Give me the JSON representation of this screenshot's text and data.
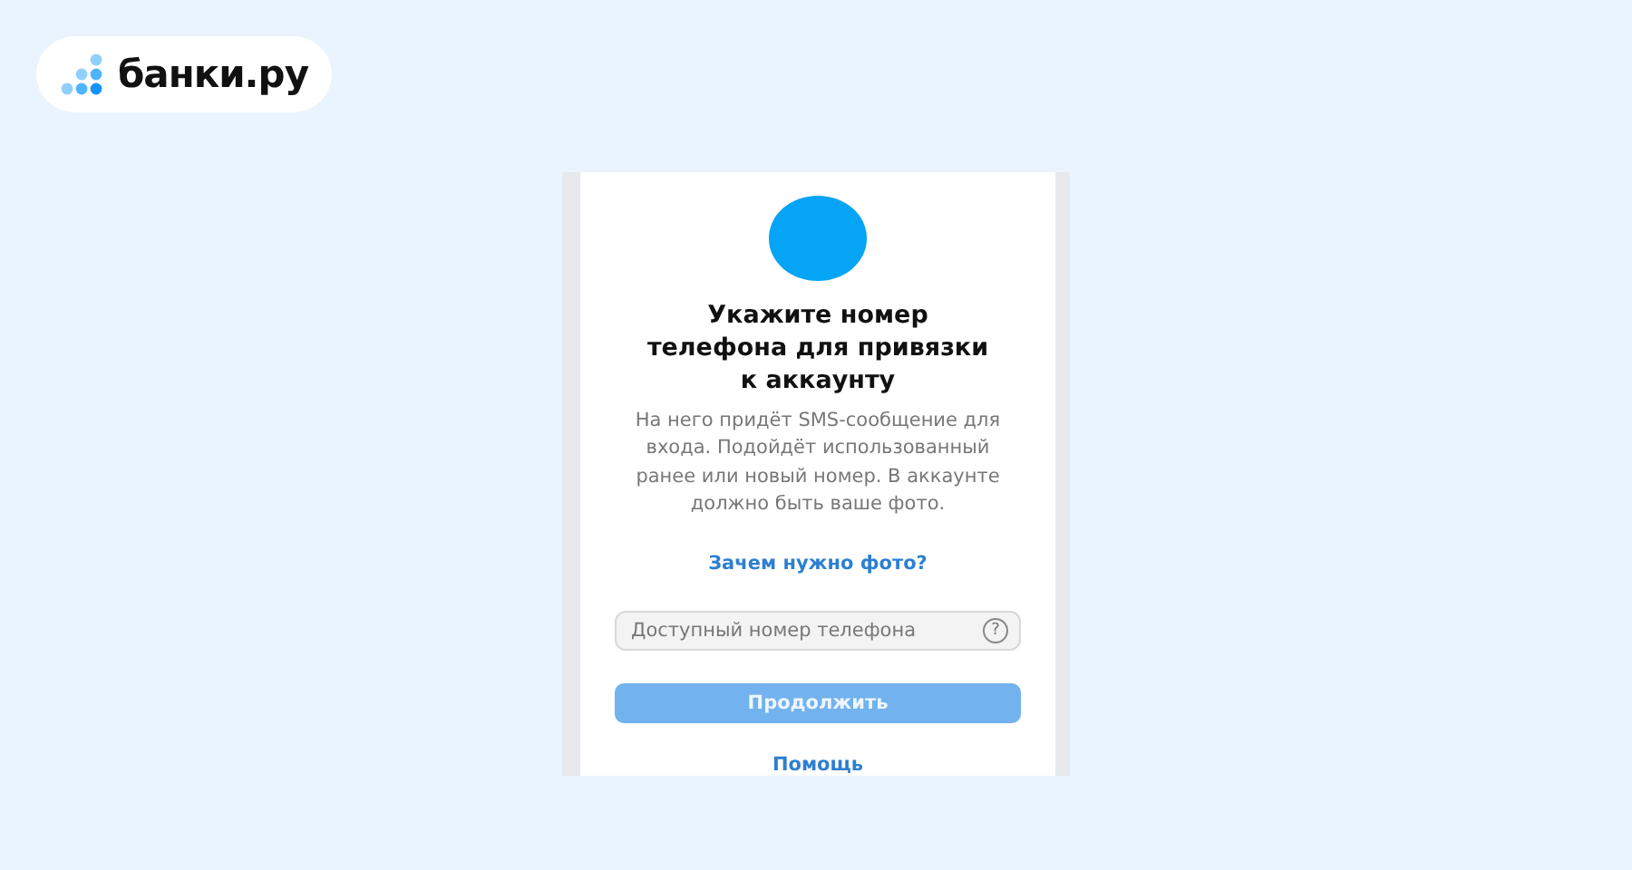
{
  "logo": {
    "text": "банки.ру"
  },
  "form": {
    "title": "Укажите номер телефона для привязки к аккаунту",
    "description": "На него придёт SMS-сообщение для входа. Подойдёт использованный ранее или новый номер. В аккаунте должно быть ваше фото.",
    "photo_link": "Зачем нужно фото?",
    "phone_field": {
      "placeholder": "Доступный номер телефона",
      "help": "?"
    },
    "continue_button": {
      "label": "Продолжить",
      "disabled": true
    },
    "help_link": "Помощь"
  }
}
